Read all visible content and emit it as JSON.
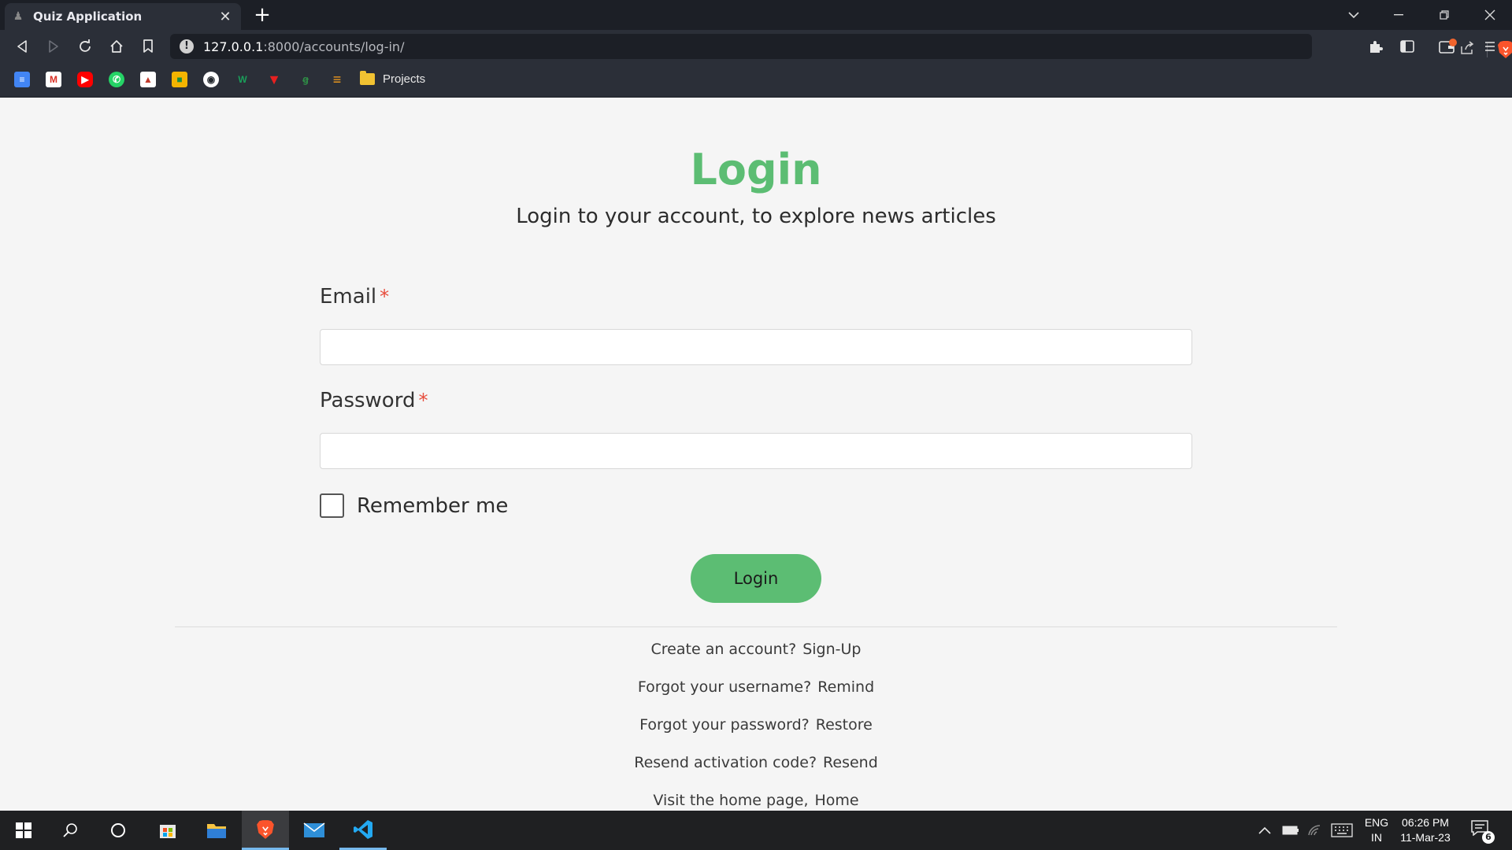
{
  "browser": {
    "tab_title": "Quiz Application",
    "tab_close": "✕",
    "new_tab": "+",
    "url_host": "127.0.0.1",
    "url_path": ":8000/accounts/log-in/",
    "bookmarks_folder": "Projects"
  },
  "login": {
    "heading": "Login",
    "subheading": "Login to your account, to explore news articles",
    "email_label": "Email",
    "password_label": "Password",
    "required_mark": "*",
    "email_value": "",
    "password_value": "",
    "remember_label": "Remember me",
    "submit_label": "Login"
  },
  "links": [
    {
      "text": "Create an account?",
      "link": "Sign-Up"
    },
    {
      "text": "Forgot your username?",
      "link": "Remind"
    },
    {
      "text": "Forgot your password?",
      "link": "Restore"
    },
    {
      "text": "Resend activation code?",
      "link": "Resend"
    },
    {
      "text": "Visit the home page,",
      "link": "Home"
    }
  ],
  "taskbar": {
    "lang_top": "ENG",
    "lang_bottom": "IN",
    "time": "06:26 PM",
    "date": "11-Mar-23",
    "notification_count": "6"
  },
  "colors": {
    "accent": "#5cbd73",
    "required": "#e74c3c",
    "browser_dark": "#1c1f26",
    "browser_toolbar": "#2b2f38"
  }
}
